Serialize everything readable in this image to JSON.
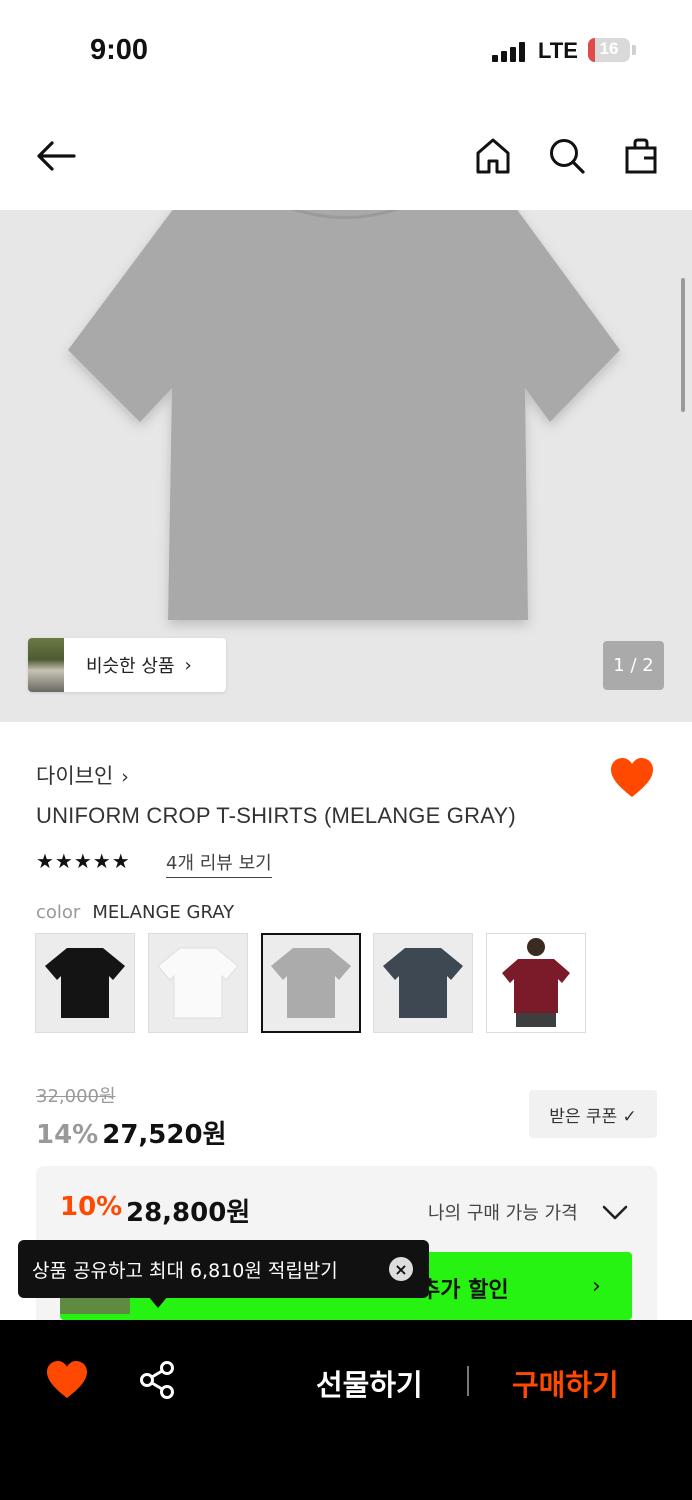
{
  "status_bar": {
    "time": "9:00",
    "network": "LTE",
    "battery": "16",
    "battery_level": 0.16
  },
  "nav": {
    "back_icon": "arrow-left-icon",
    "home_icon": "home-icon",
    "search_icon": "search-icon",
    "bag_icon": "shopping-bag-icon"
  },
  "hero": {
    "similar_label": "비슷한 상품",
    "similar_chevron": "›",
    "pager": "1 / 2"
  },
  "product": {
    "brand": "다이브인",
    "brand_chevron": "›",
    "title": "UNIFORM CROP T-SHIRTS (MELANGE GRAY)",
    "stars": "★★★★★",
    "review_link": "4개 리뷰 보기",
    "color_label": "color",
    "color_value": "MELANGE GRAY",
    "swatches": [
      "black",
      "white",
      "melange-gray",
      "navy-charcoal",
      "burgundy-model"
    ],
    "selected_swatch": "melange-gray"
  },
  "price": {
    "original": "32,000원",
    "discount_pct": "14%",
    "discount_price": "27,520원",
    "coupon_label": "받은 쿠폰 ✓"
  },
  "my_price": {
    "pct": "10%",
    "price": "28,800원",
    "label": "나의 구매 가능 가격",
    "banner_text": "추가 할인",
    "banner_chevron": "›"
  },
  "toast": {
    "text": "상품 공유하고 최대 6,810원 적립받기",
    "close": "×"
  },
  "bottom_bar": {
    "gift": "선물하기",
    "buy": "구매하기"
  },
  "colors": {
    "accent": "#ff4800",
    "heart": "#ff4800",
    "banner_green": "#26f312",
    "bottom_bar": "#000000"
  }
}
